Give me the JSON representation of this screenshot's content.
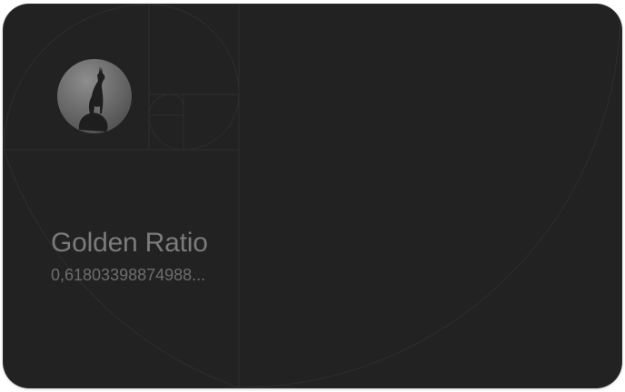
{
  "card": {
    "title": "Golden Ratio",
    "value_text": "0,61803398874988..."
  },
  "logo": {
    "icon": "gazelle-silhouette-icon"
  },
  "colors": {
    "card_background": "#222222",
    "guide_lines": "#2b2b2b",
    "title_text": "#7b7b7b",
    "value_text": "#6e6e6e"
  }
}
